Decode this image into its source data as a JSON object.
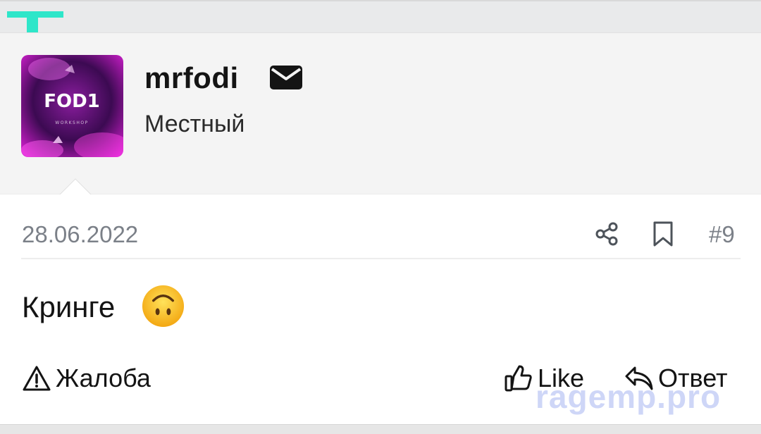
{
  "post": {
    "author": {
      "username": "mrfodi",
      "user_title": "Местный",
      "avatar_logo_text": "FOD1",
      "avatar_caption": "WORKSHOP"
    },
    "date": "28.06.2022",
    "number": "#9",
    "message": "Кринге",
    "message_emoji": "upside-down-face",
    "actions": {
      "report_label": "Жалоба",
      "like_label": "Like",
      "reply_label": "Ответ"
    }
  },
  "watermark": "ragemp.pro",
  "icons": [
    "mail-icon",
    "share-icon",
    "bookmark-icon",
    "warning-icon",
    "thumbs-up-icon",
    "reply-icon"
  ],
  "colors": {
    "accent": "#2ee6c9",
    "muted_text": "#7b8088",
    "watermark": "#c9d2f7"
  }
}
